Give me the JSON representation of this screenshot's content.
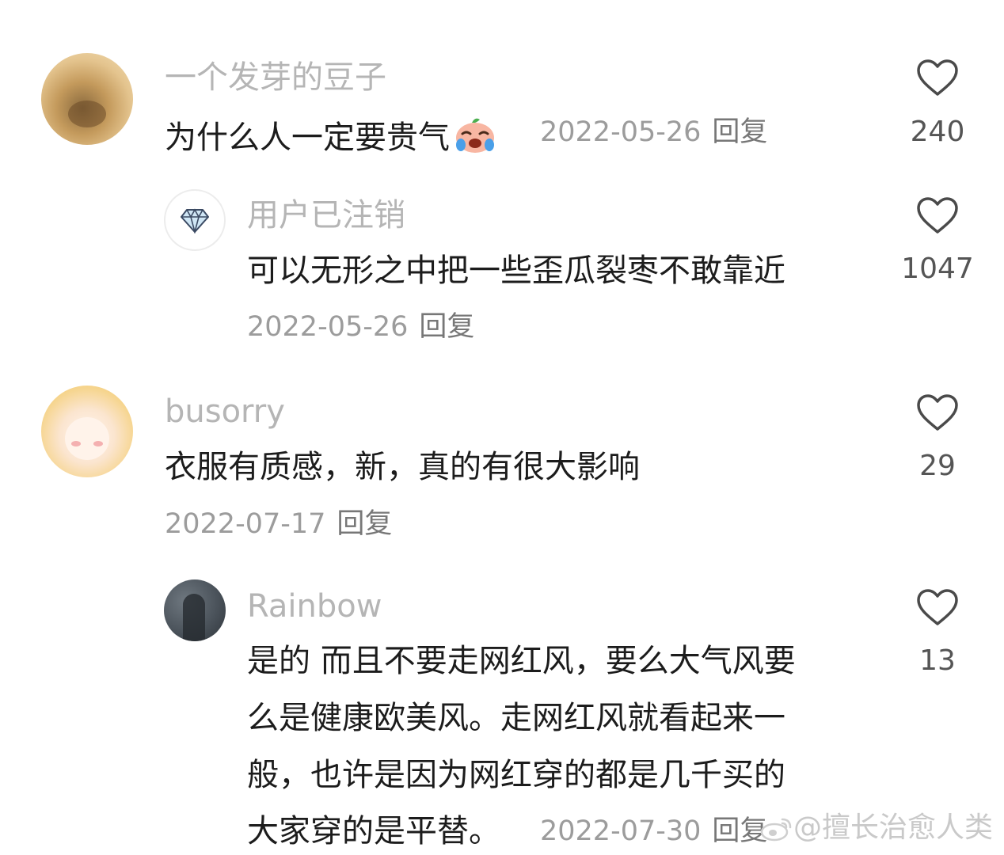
{
  "comments": [
    {
      "username": "一个发芽的豆子",
      "text": "为什么人一定要贵气",
      "emoji": "crying-face-emoji",
      "date": "2022-05-26",
      "reply_label": "回复",
      "likes": "240"
    },
    {
      "username": "用户已注销",
      "text": "可以无形之中把一些歪瓜裂枣不敢靠近",
      "date": "2022-05-26",
      "reply_label": "回复",
      "likes": "1047"
    },
    {
      "username": "busorry",
      "text": "衣服有质感，新，真的有很大影响",
      "date": "2022-07-17",
      "reply_label": "回复",
      "likes": "29"
    },
    {
      "username": "Rainbow",
      "lines": [
        "是的 而且不要走网红风，要么大气风要",
        "么是健康欧美风。走网红风就看起来一",
        "般，也许是因为网红穿的都是几千买的",
        "大家穿的是平替。"
      ],
      "date": "2022-07-30",
      "reply_label": "回复",
      "likes": "13"
    }
  ],
  "watermark": "@擅长治愈人类",
  "colors": {
    "username": "#b5b5b5",
    "text": "#1c1c1c",
    "meta": "#9c9c9c",
    "heart_stroke": "#4a4a4a"
  }
}
